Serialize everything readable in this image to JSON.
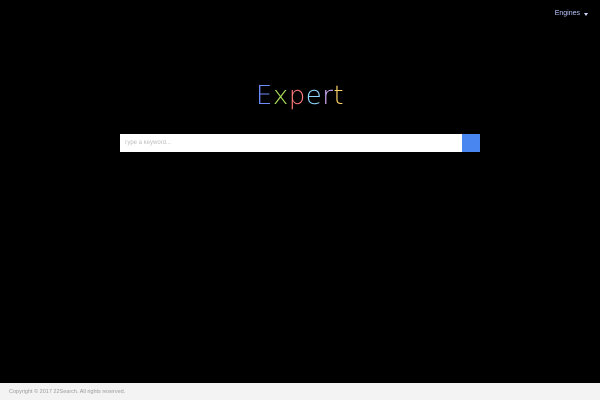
{
  "header": {
    "engines_label": "Engines"
  },
  "logo": {
    "letters": [
      "E",
      "x",
      "p",
      "e",
      "r",
      "t"
    ],
    "colors": [
      "#6f8cff",
      "#aee25a",
      "#ff7a7a",
      "#8fd6ff",
      "#d9b0ff",
      "#ffd36b"
    ]
  },
  "search": {
    "placeholder": "Type a keyword...",
    "value": "",
    "button_color": "#4a86f0"
  },
  "footer": {
    "copyright": "Copyright © 2017 22Search. All rights reserved."
  }
}
